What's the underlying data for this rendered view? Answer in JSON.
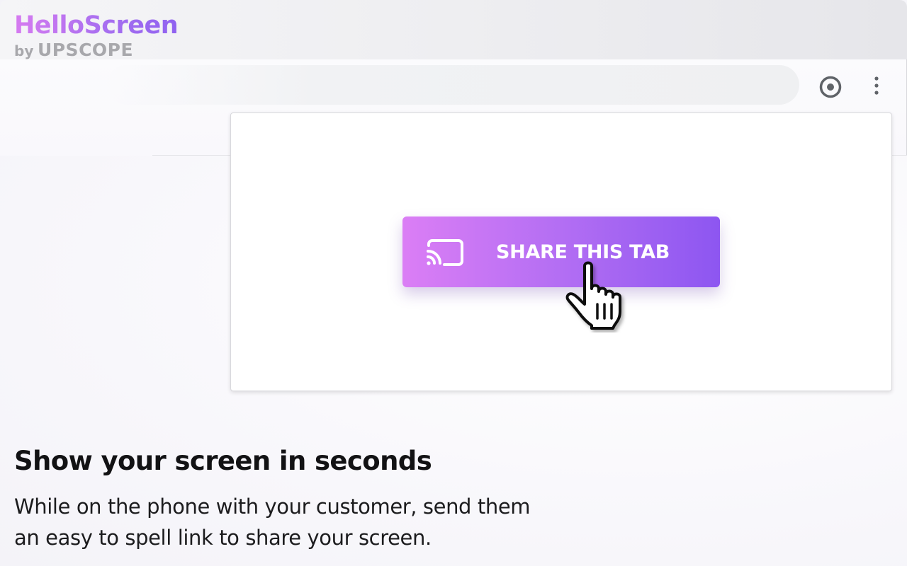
{
  "brand": {
    "title": "HelloScreen",
    "byline_prefix": "by",
    "byline_company": "UPSCOPE",
    "colors": {
      "gradient_start": "#d67bf0",
      "gradient_end": "#8f62f0",
      "byline": "#a8a8ac"
    }
  },
  "toolbar": {
    "extension_icon": "eye-target-icon",
    "menu_icon": "vertical-dots-icon"
  },
  "popup": {
    "share_button_label": "SHARE THIS TAB",
    "share_button_icon": "cast-icon",
    "button_colors": {
      "start": "#db7ef5",
      "end": "#8d56f1"
    },
    "cursor_icon": "hand-pointer-icon"
  },
  "marketing": {
    "headline": "Show your screen in seconds",
    "description": "While on the phone with your customer, send them an easy to spell link to share your screen."
  }
}
